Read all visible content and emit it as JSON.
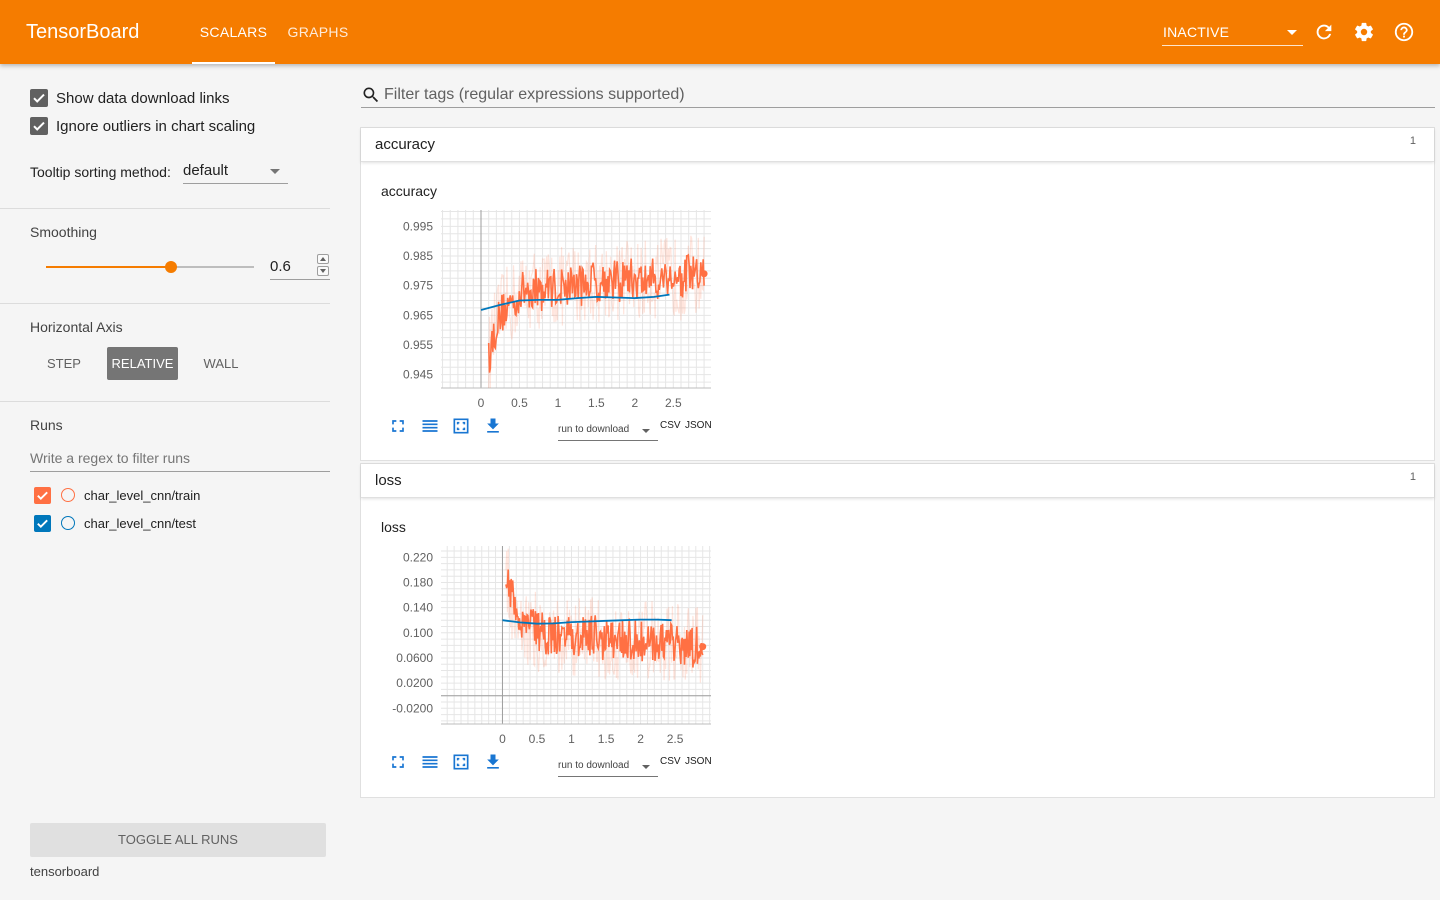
{
  "app": {
    "title": "TensorBoard"
  },
  "tabs": [
    {
      "label": "SCALARS"
    },
    {
      "label": "GRAPHS"
    }
  ],
  "status": {
    "value": "INACTIVE"
  },
  "colors": {
    "accent": "#f57c00",
    "train": "#ff7043",
    "test": "#0077bb"
  },
  "sidebar": {
    "show_links_label": "Show data download links",
    "ignore_outliers_label": "Ignore outliers in chart scaling",
    "tooltip_sort_label": "Tooltip sorting method:",
    "tooltip_sort_value": "default",
    "smoothing_label": "Smoothing",
    "smoothing_value": "0.6",
    "smoothing_fraction": 0.6,
    "horizontal_axis_label": "Horizontal Axis",
    "axis_options": [
      "STEP",
      "RELATIVE",
      "WALL"
    ],
    "axis_selected": "RELATIVE",
    "runs_label": "Runs",
    "runs_filter_placeholder": "Write a regex to filter runs",
    "runs": [
      {
        "name": "char_level_cnn/train",
        "checked": true,
        "color": "#ff7043"
      },
      {
        "name": "char_level_cnn/test",
        "checked": true,
        "color": "#0077bb"
      }
    ],
    "toggle_all_label": "TOGGLE ALL RUNS",
    "footer": "tensorboard"
  },
  "main": {
    "filter_placeholder": "Filter tags (regular expressions supported)",
    "categories": [
      {
        "name": "accuracy",
        "count": "1",
        "card_title": "accuracy"
      },
      {
        "name": "loss",
        "count": "1",
        "card_title": "loss"
      }
    ],
    "run_download_label": "run to download",
    "csv_label": "CSV",
    "json_label": "JSON"
  },
  "chart_data": [
    {
      "type": "line",
      "title": "accuracy",
      "xlabel": "",
      "ylabel": "",
      "x_ticks": [
        "0",
        "0.5",
        "1",
        "1.5",
        "2",
        "2.5"
      ],
      "y_ticks": [
        "0.945",
        "0.955",
        "0.965",
        "0.975",
        "0.985",
        "0.995"
      ],
      "xlim": [
        -0.52,
        2.99
      ],
      "ylim": [
        0.9405,
        1.0005
      ],
      "grid": true,
      "series": [
        {
          "name": "char_level_cnn/train",
          "color": "#ff7043",
          "x": [
            0.1,
            0.2,
            0.3,
            0.4,
            0.5,
            0.6,
            0.7,
            0.8,
            0.9,
            1.0,
            1.1,
            1.2,
            1.3,
            1.4,
            1.5,
            1.6,
            1.7,
            1.8,
            1.9,
            2.0,
            2.1,
            2.2,
            2.3,
            2.4,
            2.5,
            2.6,
            2.7,
            2.8,
            2.9
          ],
          "y": [
            0.951,
            0.962,
            0.967,
            0.969,
            0.972,
            0.974,
            0.974,
            0.973,
            0.975,
            0.974,
            0.975,
            0.976,
            0.975,
            0.977,
            0.976,
            0.977,
            0.977,
            0.976,
            0.978,
            0.977,
            0.976,
            0.978,
            0.977,
            0.978,
            0.978,
            0.977,
            0.979,
            0.978,
            0.979
          ]
        },
        {
          "name": "char_level_cnn/test",
          "color": "#0077bb",
          "x": [
            0.0,
            0.25,
            0.5,
            0.75,
            1.0,
            1.25,
            1.5,
            1.75,
            2.0,
            2.25,
            2.45
          ],
          "y": [
            0.9668,
            0.9685,
            0.97,
            0.9702,
            0.9702,
            0.9708,
            0.9712,
            0.971,
            0.9708,
            0.9712,
            0.972
          ]
        }
      ]
    },
    {
      "type": "line",
      "title": "loss",
      "xlabel": "",
      "ylabel": "",
      "x_ticks": [
        "0",
        "0.5",
        "1",
        "1.5",
        "2",
        "2.5"
      ],
      "y_ticks": [
        "-0.0200",
        "0.0200",
        "0.0600",
        "0.100",
        "0.140",
        "0.180",
        "0.220"
      ],
      "xlim": [
        -0.89,
        3.02
      ],
      "ylim": [
        -0.045,
        0.238
      ],
      "grid": true,
      "series": [
        {
          "name": "char_level_cnn/train",
          "color": "#ff7043",
          "x": [
            0.05,
            0.15,
            0.25,
            0.35,
            0.45,
            0.55,
            0.65,
            0.75,
            0.85,
            0.95,
            1.05,
            1.15,
            1.25,
            1.35,
            1.45,
            1.55,
            1.65,
            1.75,
            1.85,
            1.95,
            2.05,
            2.15,
            2.25,
            2.35,
            2.45,
            2.55,
            2.65,
            2.75,
            2.9
          ],
          "y": [
            0.195,
            0.15,
            0.125,
            0.11,
            0.105,
            0.1,
            0.095,
            0.098,
            0.092,
            0.095,
            0.09,
            0.094,
            0.092,
            0.096,
            0.088,
            0.094,
            0.09,
            0.092,
            0.089,
            0.09,
            0.087,
            0.09,
            0.086,
            0.085,
            0.082,
            0.08,
            0.078,
            0.076,
            0.078
          ]
        },
        {
          "name": "char_level_cnn/test",
          "color": "#0077bb",
          "x": [
            0.0,
            0.25,
            0.5,
            0.75,
            1.0,
            1.25,
            1.5,
            1.75,
            2.0,
            2.25,
            2.45
          ],
          "y": [
            0.12,
            0.1165,
            0.1145,
            0.115,
            0.117,
            0.118,
            0.119,
            0.12,
            0.121,
            0.121,
            0.12
          ]
        }
      ]
    }
  ]
}
